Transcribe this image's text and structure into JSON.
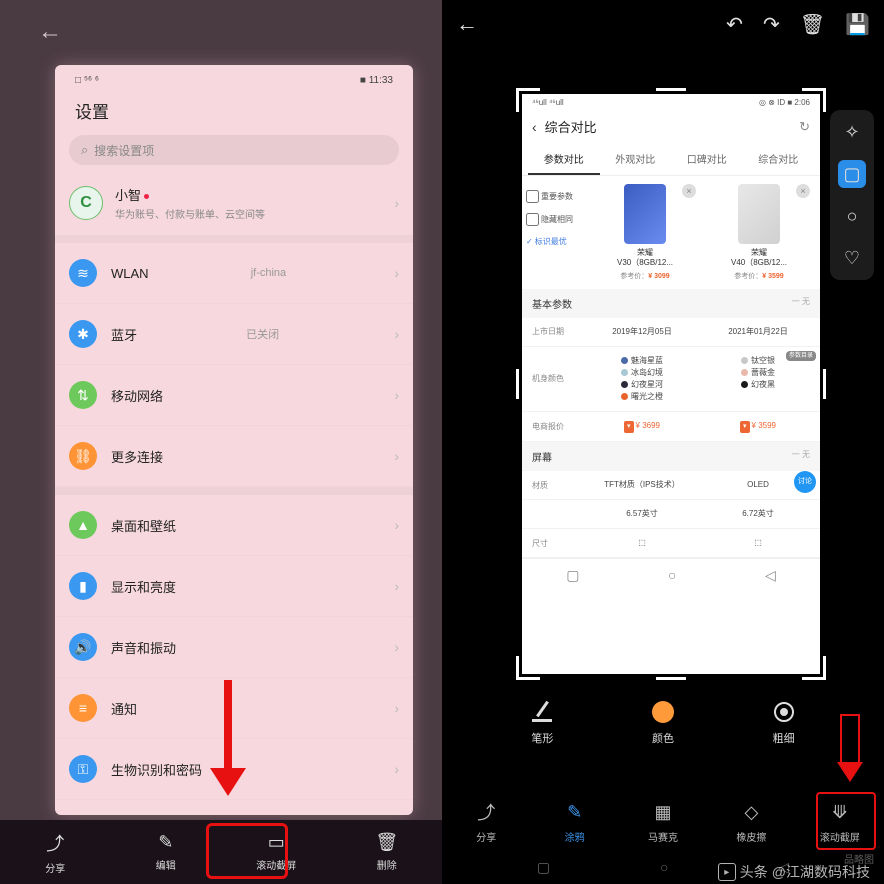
{
  "left": {
    "status_left": "□ ⁵⁶ ⁶",
    "status_right": "■ 11:33",
    "title": "设置",
    "search_placeholder": "搜索设置项",
    "profile_name": "小智",
    "profile_sub": "华为账号、付款与账单、云空间等",
    "rows": [
      {
        "label": "WLAN",
        "value": "jf-china",
        "icon": "wifi"
      },
      {
        "label": "蓝牙",
        "value": "已关闭",
        "icon": "bt"
      },
      {
        "label": "移动网络",
        "value": "",
        "icon": "net"
      },
      {
        "label": "更多连接",
        "value": "",
        "icon": "more"
      },
      {
        "label": "桌面和壁纸",
        "value": "",
        "icon": "wall"
      },
      {
        "label": "显示和亮度",
        "value": "",
        "icon": "disp"
      },
      {
        "label": "声音和振动",
        "value": "",
        "icon": "sound"
      },
      {
        "label": "通知",
        "value": "",
        "icon": "notif"
      },
      {
        "label": "生物识别和密码",
        "value": "",
        "icon": "bio"
      }
    ],
    "toolbar": [
      {
        "label": "分享",
        "icon": "share"
      },
      {
        "label": "编辑",
        "icon": "edit"
      },
      {
        "label": "滚动截屏",
        "icon": "scroll"
      },
      {
        "label": "删除",
        "icon": "delete"
      }
    ]
  },
  "right": {
    "inner": {
      "status_left": "⁴⁶ull ⁴⁶ull",
      "status_right": "◎ ⊗ ID ■ 2:06",
      "head_title": "综合对比",
      "tabs": [
        "参数对比",
        "外观对比",
        "口碑对比",
        "综合对比"
      ],
      "opts": {
        "o1": "重要参数",
        "o2": "隐藏相同",
        "o3": "标识最优"
      },
      "products": [
        {
          "name_l1": "荣耀",
          "name_l2": "V30（8GB/12...",
          "ref": "参考价：",
          "price": "¥ 3099"
        },
        {
          "name_l1": "荣耀",
          "name_l2": "V40（8GB/12...",
          "ref": "参考价：",
          "price": "¥ 3599"
        }
      ],
      "sect_basic": "基本参数",
      "sect_none": "一 无",
      "row_date_label": "上市日期",
      "row_date_v1": "2019年12月05日",
      "row_date_v2": "2021年01月22日",
      "row_color_label": "机身颜色",
      "colors1": [
        {
          "c": "#4a6aa8",
          "n": "魅海星蓝"
        },
        {
          "c": "#a8c8d4",
          "n": "冰岛幻境"
        },
        {
          "c": "#2a2a3a",
          "n": "幻夜星河"
        },
        {
          "c": "#e8642a",
          "n": "曙光之橙"
        }
      ],
      "colors2": [
        {
          "c": "#c8c8c8",
          "n": "钛空银"
        },
        {
          "c": "#e8b8a8",
          "n": "蔷薇金"
        },
        {
          "c": "#1a1a1a",
          "n": "幻夜黑"
        }
      ],
      "badge_catalog": "参数目录",
      "row_quote_label": "电商报价",
      "quote_v1": "¥ 3699",
      "quote_v2": "¥ 3599",
      "sect_screen": "屏幕",
      "row_mat_label": "材质",
      "mat_v1": "TFT材质（IPS技术）",
      "mat_v2": "OLED",
      "discuss": "讨论",
      "size_v1": "6.57英寸",
      "size_v2": "6.72英寸",
      "row_size_label": "尺寸"
    },
    "tools1": [
      {
        "label": "笔形"
      },
      {
        "label": "颜色"
      },
      {
        "label": "粗细"
      }
    ],
    "tools2": [
      {
        "label": "分享",
        "icon": "share"
      },
      {
        "label": "涂鸦",
        "icon": "doodle"
      },
      {
        "label": "马赛克",
        "icon": "mosaic"
      },
      {
        "label": "橡皮擦",
        "icon": "eraser"
      },
      {
        "label": "滚动截屏",
        "icon": "scroll"
      }
    ]
  },
  "watermark": {
    "brand": "头条",
    "author": "@江湖数码科技",
    "site": "品略图"
  }
}
